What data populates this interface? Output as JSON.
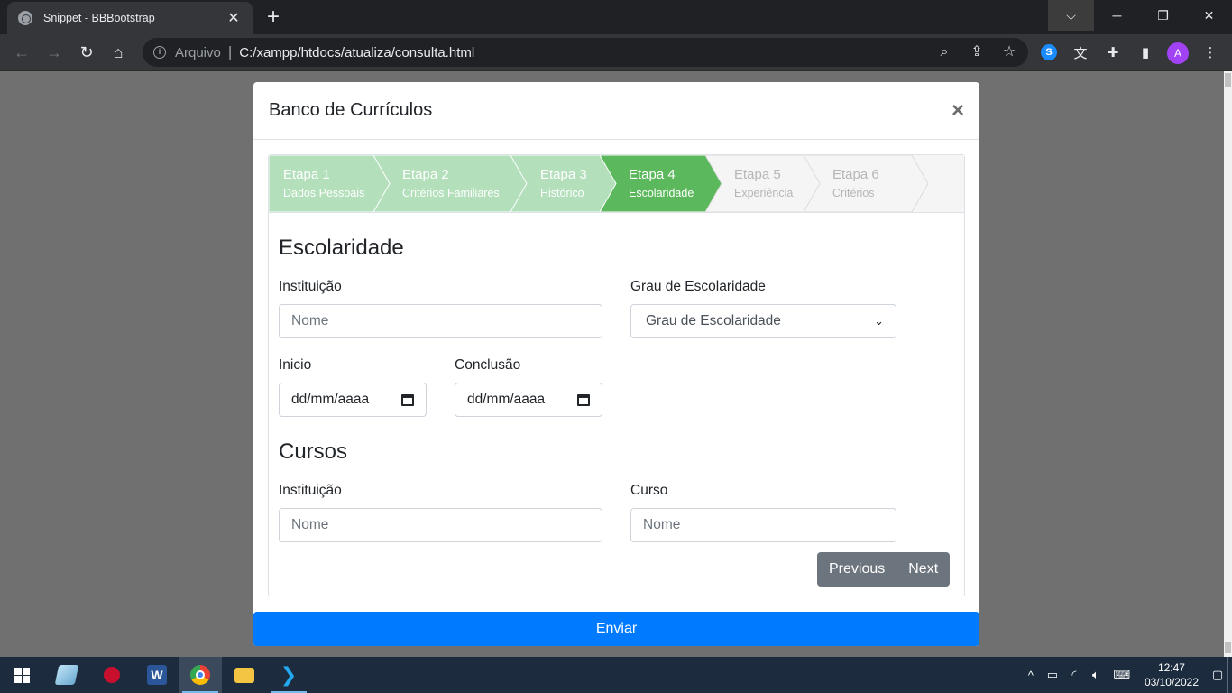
{
  "browser": {
    "tab_title": "Snippet - BBBootstrap",
    "tab_close": "✕",
    "new_tab": "+",
    "scheme_label": "Arquivo",
    "url": "C:/xampp/htdocs/atualiza/consulta.html",
    "avatar_letter": "A"
  },
  "modal": {
    "title": "Banco de Currículos",
    "close": "×"
  },
  "steps": [
    {
      "title": "Etapa 1",
      "subtitle": "Dados Pessoais",
      "state": "done"
    },
    {
      "title": "Etapa 2",
      "subtitle": "Critérios Familiares",
      "state": "done"
    },
    {
      "title": "Etapa 3",
      "subtitle": "Histórico",
      "state": "done"
    },
    {
      "title": "Etapa 4",
      "subtitle": "Escolaridade",
      "state": "active"
    },
    {
      "title": "Etapa 5",
      "subtitle": "Experiência",
      "state": "todo"
    },
    {
      "title": "Etapa 6",
      "subtitle": "Critérios",
      "state": "todo"
    }
  ],
  "escolaridade": {
    "heading": "Escolaridade",
    "instituicao_label": "Instituição",
    "instituicao_placeholder": "Nome",
    "grau_label": "Grau de Escolaridade",
    "grau_selected": "Grau de Escolaridade",
    "inicio_label": "Inicio",
    "inicio_value": "dd/mm/aaaa",
    "conclusao_label": "Conclusão",
    "conclusao_value": "dd/mm/aaaa"
  },
  "cursos": {
    "heading": "Cursos",
    "instituicao_label": "Instituição",
    "instituicao_placeholder": "Nome",
    "curso_label": "Curso",
    "curso_placeholder": "Nome"
  },
  "buttons": {
    "previous": "Previous",
    "next": "Next",
    "submit": "Enviar"
  },
  "taskbar": {
    "time": "12:47",
    "date": "03/10/2022"
  },
  "colors": {
    "step_done": "#b3dfbb",
    "step_active": "#5cb85c",
    "step_todo": "#f5f5f5",
    "primary": "#007bff",
    "secondary": "#6c757d"
  }
}
